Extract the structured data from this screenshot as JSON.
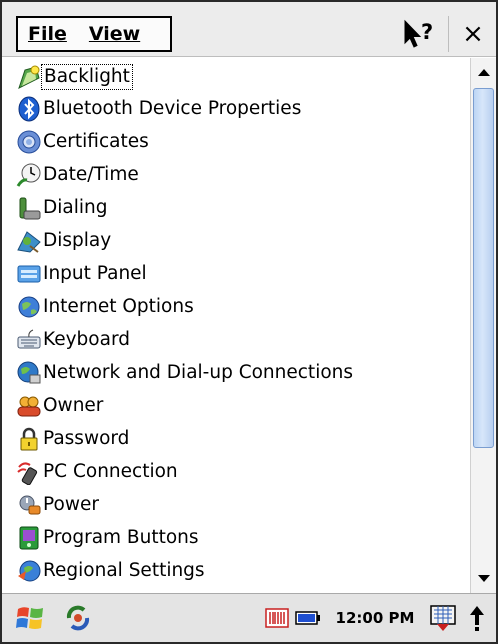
{
  "menu": {
    "file_label": "File",
    "view_label": "View",
    "help_label": "?",
    "close_label": "×"
  },
  "items": [
    {
      "label": "Backlight",
      "icon": "backlight-icon",
      "focused": true
    },
    {
      "label": "Bluetooth Device Properties",
      "icon": "bluetooth-icon"
    },
    {
      "label": "Certificates",
      "icon": "certificates-icon"
    },
    {
      "label": "Date/Time",
      "icon": "date-time-icon"
    },
    {
      "label": "Dialing",
      "icon": "dialing-icon"
    },
    {
      "label": "Display",
      "icon": "display-icon"
    },
    {
      "label": "Input Panel",
      "icon": "input-panel-icon"
    },
    {
      "label": "Internet Options",
      "icon": "internet-options-icon"
    },
    {
      "label": "Keyboard",
      "icon": "keyboard-icon"
    },
    {
      "label": "Network and Dial-up Connections",
      "icon": "network-icon"
    },
    {
      "label": "Owner",
      "icon": "owner-icon"
    },
    {
      "label": "Password",
      "icon": "password-icon"
    },
    {
      "label": "PC Connection",
      "icon": "pc-connection-icon"
    },
    {
      "label": "Power",
      "icon": "power-icon"
    },
    {
      "label": "Program Buttons",
      "icon": "program-buttons-icon"
    },
    {
      "label": "Regional Settings",
      "icon": "regional-settings-icon"
    }
  ],
  "taskbar": {
    "time": "12:00 PM",
    "icons": [
      "windows-start-icon",
      "sync-icon",
      "barcode-icon",
      "battery-icon",
      "keyboard-icon",
      "sip-arrow-icon"
    ]
  },
  "colors": {
    "accent_blue": "#1e5fd0",
    "scroll_thumb": "#c8dcf7",
    "bar_background": "#ececec"
  }
}
